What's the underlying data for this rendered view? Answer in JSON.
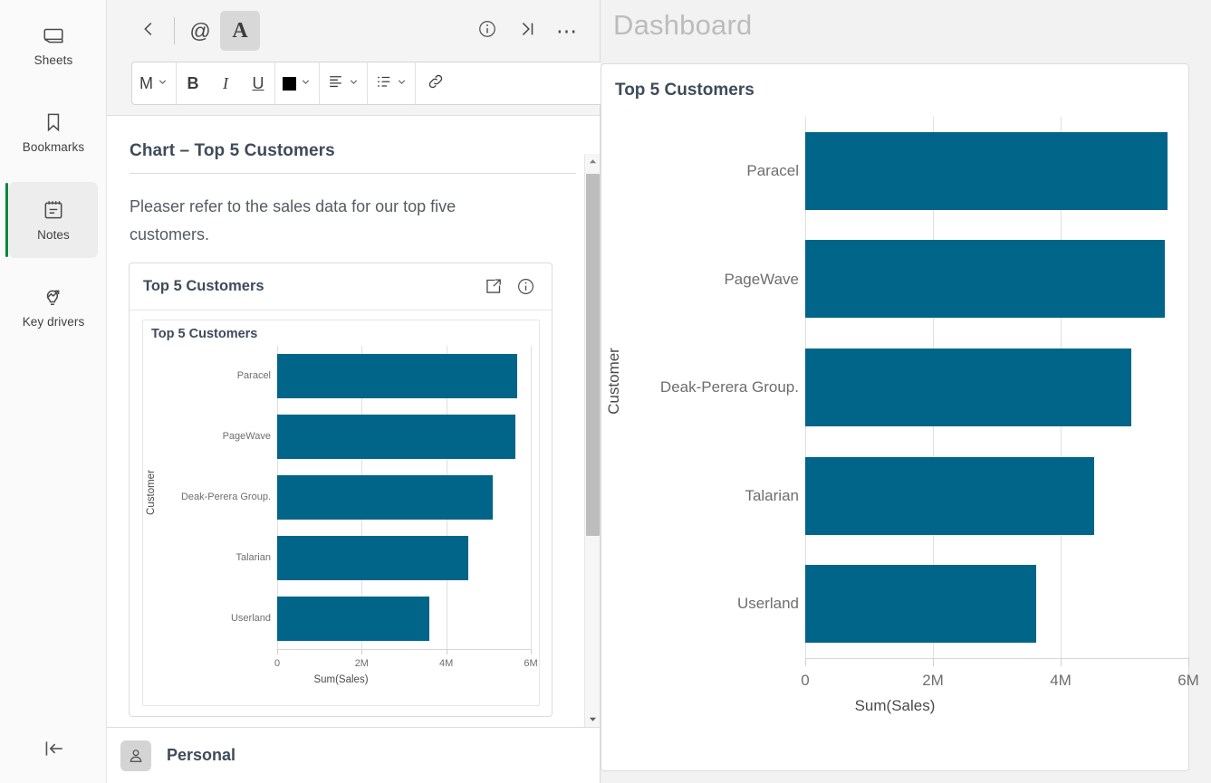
{
  "sidebar": {
    "items": [
      {
        "label": "Sheets",
        "icon": "sheets-icon",
        "active": false
      },
      {
        "label": "Bookmarks",
        "icon": "bookmark-icon",
        "active": false
      },
      {
        "label": "Notes",
        "icon": "notes-icon",
        "active": true
      },
      {
        "label": "Key drivers",
        "icon": "key-drivers-icon",
        "active": false
      }
    ],
    "collapse_icon": "collapse-left-icon",
    "active_accent_color": "#00873D"
  },
  "notes_panel": {
    "toolbar": {
      "back_icon": "chevron-left-icon",
      "mention_label": "@",
      "text_format_label": "A",
      "info_icon": "info-circle-icon",
      "collapse_right_icon": "collapse-right-icon",
      "more_icon": "more-horizontal-icon",
      "format_bar": {
        "size_label": "M",
        "bold_label": "B",
        "italic_label": "I",
        "underline_label": "U",
        "color_value": "#000000",
        "align_icon": "align-left-icon",
        "list_icon": "bullet-list-icon",
        "link_icon": "link-icon",
        "chevron": "⌄"
      }
    },
    "note": {
      "title": "Chart – Top 5 Customers",
      "body": "Pleaser refer to the sales data for our top five customers."
    },
    "embedded_card": {
      "title": "Top 5 Customers",
      "share_icon": "share-export-icon",
      "info_icon": "info-circle-icon"
    },
    "footer": {
      "avatar_icon": "user-avatar-icon",
      "label": "Personal"
    },
    "scrollbar": {
      "up_icon": "scroll-up-arrow",
      "down_icon": "scroll-down-arrow"
    }
  },
  "dashboard": {
    "title": "Dashboard",
    "card_title": "Top 5 Customers"
  },
  "chart_data": [
    {
      "id": "note-embedded-chart",
      "type": "bar",
      "orientation": "horizontal",
      "title": "Top 5 Customers",
      "categories": [
        "Paracel",
        "PageWave",
        "Deak-Perera Group.",
        "Talarian",
        "Userland"
      ],
      "values": [
        5.67,
        5.63,
        5.1,
        4.53,
        3.61
      ],
      "value_unit": "M",
      "xlabel": "Sum(Sales)",
      "ylabel": "Customer",
      "xlim": [
        0,
        6
      ],
      "xticks": [
        0,
        2,
        4,
        6
      ],
      "xtick_labels": [
        "0",
        "2M",
        "4M",
        "6M"
      ],
      "grid": true,
      "legend": false,
      "bar_color": "#006588"
    },
    {
      "id": "dashboard-chart",
      "type": "bar",
      "orientation": "horizontal",
      "title": "Top 5 Customers",
      "categories": [
        "Paracel",
        "PageWave",
        "Deak-Perera Group.",
        "Talarian",
        "Userland"
      ],
      "values": [
        5.67,
        5.63,
        5.1,
        4.53,
        3.61
      ],
      "value_unit": "M",
      "xlabel": "Sum(Sales)",
      "ylabel": "Customer",
      "xlim": [
        0,
        6
      ],
      "xticks": [
        0,
        2,
        4,
        6
      ],
      "xtick_labels": [
        "0",
        "2M",
        "4M",
        "6M"
      ],
      "grid": true,
      "legend": false,
      "bar_color": "#006588"
    }
  ]
}
